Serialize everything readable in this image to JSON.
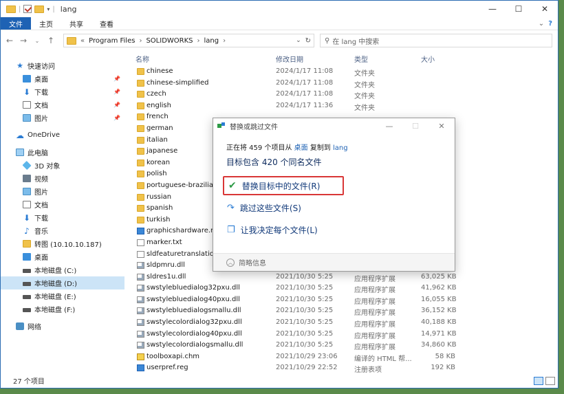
{
  "window": {
    "title": "lang",
    "controls": [
      "—",
      "☐",
      "✕"
    ]
  },
  "ribbon": {
    "tabs": [
      "文件",
      "主页",
      "共享",
      "查看"
    ],
    "active": "文件"
  },
  "address": {
    "crumbs": [
      "«",
      "Program Files",
      "›",
      "SOLIDWORKS",
      "›",
      "lang",
      "›"
    ],
    "search_placeholder": "在 lang 中搜索"
  },
  "sidebar": {
    "items": [
      {
        "label": "快速访问",
        "icon": "star-icon"
      },
      {
        "label": "桌面",
        "icon": "desktop-icon",
        "pinned": true
      },
      {
        "label": "下载",
        "icon": "download-icon",
        "pinned": true
      },
      {
        "label": "文档",
        "icon": "document-icon",
        "pinned": true
      },
      {
        "label": "图片",
        "icon": "picture-icon",
        "pinned": true
      },
      {
        "label": "OneDrive",
        "icon": "cloud-icon"
      },
      {
        "label": "此电脑",
        "icon": "computer-icon"
      },
      {
        "label": "3D 对象",
        "icon": "3d-objects-icon"
      },
      {
        "label": "视频",
        "icon": "video-icon"
      },
      {
        "label": "图片",
        "icon": "picture-icon"
      },
      {
        "label": "文档",
        "icon": "document-icon"
      },
      {
        "label": "下载",
        "icon": "download-icon"
      },
      {
        "label": "音乐",
        "icon": "music-icon"
      },
      {
        "label": "转图 (10.10.10.187)",
        "icon": "network-folder-icon"
      },
      {
        "label": "桌面",
        "icon": "desktop-icon"
      },
      {
        "label": "本地磁盘 (C:)",
        "icon": "drive-icon"
      },
      {
        "label": "本地磁盘 (D:)",
        "icon": "drive-icon",
        "selected": true
      },
      {
        "label": "本地磁盘 (E:)",
        "icon": "drive-icon"
      },
      {
        "label": "本地磁盘 (F:)",
        "icon": "drive-icon"
      },
      {
        "label": "网络",
        "icon": "network-icon"
      }
    ]
  },
  "columns": {
    "name": "名称",
    "date": "修改日期",
    "type": "类型",
    "size": "大小"
  },
  "files": [
    {
      "name": "chinese",
      "date": "2024/1/17 11:08",
      "type": "文件夹",
      "size": "",
      "kind": "folder"
    },
    {
      "name": "chinese-simplified",
      "date": "2024/1/17 11:08",
      "type": "文件夹",
      "size": "",
      "kind": "folder"
    },
    {
      "name": "czech",
      "date": "2024/1/17 11:08",
      "type": "文件夹",
      "size": "",
      "kind": "folder"
    },
    {
      "name": "english",
      "date": "2024/1/17 11:36",
      "type": "文件夹",
      "size": "",
      "kind": "folder"
    },
    {
      "name": "french",
      "date": "",
      "type": "",
      "size": "",
      "kind": "folder"
    },
    {
      "name": "german",
      "date": "",
      "type": "",
      "size": "",
      "kind": "folder"
    },
    {
      "name": "italian",
      "date": "",
      "type": "",
      "size": "",
      "kind": "folder"
    },
    {
      "name": "japanese",
      "date": "",
      "type": "",
      "size": "",
      "kind": "folder"
    },
    {
      "name": "korean",
      "date": "",
      "type": "",
      "size": "",
      "kind": "folder"
    },
    {
      "name": "polish",
      "date": "",
      "type": "",
      "size": "",
      "kind": "folder"
    },
    {
      "name": "portuguese-brazilian",
      "date": "",
      "type": "",
      "size": "",
      "kind": "folder"
    },
    {
      "name": "russian",
      "date": "",
      "type": "",
      "size": "",
      "kind": "folder"
    },
    {
      "name": "spanish",
      "date": "",
      "type": "",
      "size": "",
      "kind": "folder"
    },
    {
      "name": "turkish",
      "date": "",
      "type": "",
      "size": "",
      "kind": "folder"
    },
    {
      "name": "graphicshardware.reg",
      "date": "",
      "type": "",
      "size": "",
      "kind": "reg"
    },
    {
      "name": "marker.txt",
      "date": "",
      "type": "",
      "size": "",
      "kind": "file"
    },
    {
      "name": "sldfeaturetranslations",
      "date": "",
      "type": "",
      "size": "",
      "kind": "file"
    },
    {
      "name": "sldpmru.dll",
      "date": "",
      "type": "",
      "size": "",
      "kind": "dll"
    },
    {
      "name": "sldres1u.dll",
      "date": "2021/10/30 5:25",
      "type": "应用程序扩展",
      "size": "63,025 KB",
      "kind": "dll"
    },
    {
      "name": "swstylebluedialog32pxu.dll",
      "date": "2021/10/30 5:25",
      "type": "应用程序扩展",
      "size": "41,962 KB",
      "kind": "dll"
    },
    {
      "name": "swstylebluedialog40pxu.dll",
      "date": "2021/10/30 5:25",
      "type": "应用程序扩展",
      "size": "16,055 KB",
      "kind": "dll"
    },
    {
      "name": "swstylebluedialogsmallu.dll",
      "date": "2021/10/30 5:25",
      "type": "应用程序扩展",
      "size": "36,152 KB",
      "kind": "dll"
    },
    {
      "name": "swstylecolordialog32pxu.dll",
      "date": "2021/10/30 5:25",
      "type": "应用程序扩展",
      "size": "40,188 KB",
      "kind": "dll"
    },
    {
      "name": "swstylecolordialog40pxu.dll",
      "date": "2021/10/30 5:25",
      "type": "应用程序扩展",
      "size": "14,971 KB",
      "kind": "dll"
    },
    {
      "name": "swstylecolordialogsmallu.dll",
      "date": "2021/10/30 5:25",
      "type": "应用程序扩展",
      "size": "34,860 KB",
      "kind": "dll"
    },
    {
      "name": "toolboxapi.chm",
      "date": "2021/10/29 23:06",
      "type": "编译的 HTML 帮...",
      "size": "58 KB",
      "kind": "chm"
    },
    {
      "name": "userpref.reg",
      "date": "2021/10/29 22:52",
      "type": "注册表项",
      "size": "192 KB",
      "kind": "reg"
    }
  ],
  "status": {
    "count": "27 个项目"
  },
  "dialog": {
    "title": "替换或跳过文件",
    "line1_pre": "正在将 459 个项目从",
    "line1_src": "桌面",
    "line1_mid": "复制到",
    "line1_dst": "lang",
    "heading": "目标包含 420 个同名文件",
    "option_replace": "替换目标中的文件(R)",
    "option_skip": "跳过这些文件(S)",
    "option_decide": "让我决定每个文件(L)",
    "footer": "简略信息"
  }
}
